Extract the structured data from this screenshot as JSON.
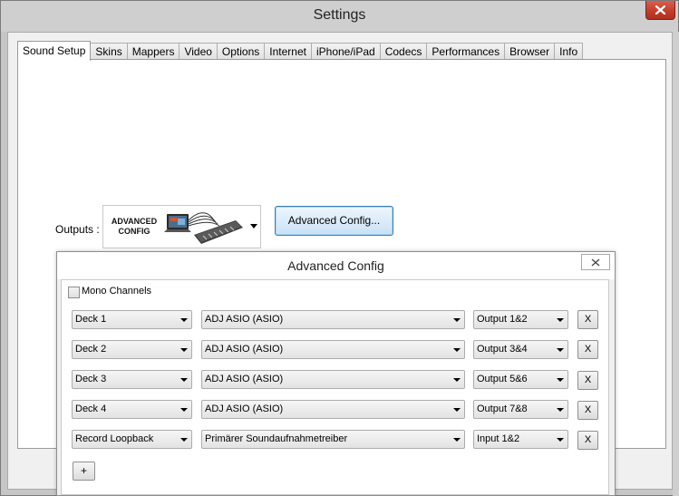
{
  "window": {
    "title": "Settings"
  },
  "tabs": [
    "Sound Setup",
    "Skins",
    "Mappers",
    "Video",
    "Options",
    "Internet",
    "iPhone/iPad",
    "Codecs",
    "Performances",
    "Browser",
    "Info"
  ],
  "active_tab": "Sound Setup",
  "outputs": {
    "label": "Outputs :",
    "selected_logo_line1": "ADVANCED",
    "selected_logo_line2": "CONFIG",
    "advanced_button": "Advanced Config..."
  },
  "dialog": {
    "title": "Advanced Config",
    "mono_label": "Mono Channels",
    "mono_checked": false,
    "rows": [
      {
        "channel": "Deck 1",
        "device": "ADJ ASIO (ASIO)",
        "port": "Output 1&2",
        "remove": "X"
      },
      {
        "channel": "Deck 2",
        "device": "ADJ ASIO (ASIO)",
        "port": "Output 3&4",
        "remove": "X"
      },
      {
        "channel": "Deck 3",
        "device": "ADJ ASIO (ASIO)",
        "port": "Output 5&6",
        "remove": "X"
      },
      {
        "channel": "Deck 4",
        "device": "ADJ ASIO (ASIO)",
        "port": "Output 7&8",
        "remove": "X"
      },
      {
        "channel": "Record Loopback",
        "device": "Primärer Soundaufnahmetreiber",
        "port": "Input 1&2",
        "remove": "X"
      }
    ],
    "add_label": "+"
  }
}
